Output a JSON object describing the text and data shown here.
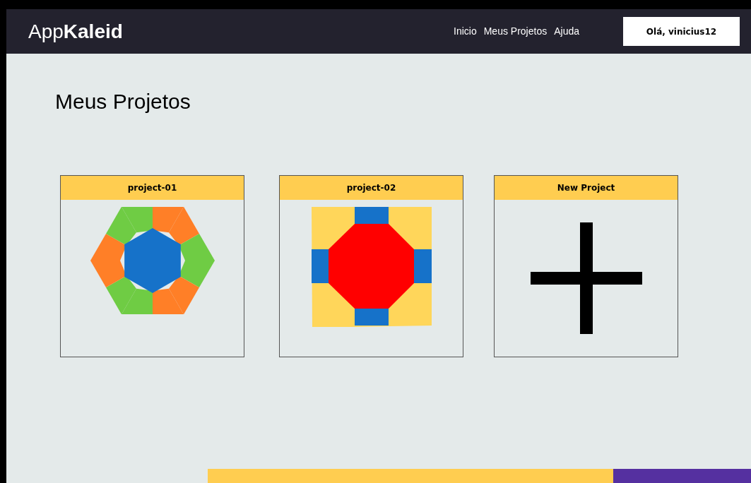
{
  "header": {
    "logo": "App**Kaleid**",
    "nav": [
      {
        "label": "Inicio"
      },
      {
        "label": "Meus Projetos"
      },
      {
        "label": "Ajuda"
      }
    ],
    "user_button": "Olá, vinicius12"
  },
  "page_title": "Meus Projetos",
  "projects": [
    {
      "title": "project-01",
      "kind": "hexagon"
    },
    {
      "title": "project-02",
      "kind": "octagon"
    },
    {
      "title": "New Project",
      "kind": "add"
    }
  ]
}
